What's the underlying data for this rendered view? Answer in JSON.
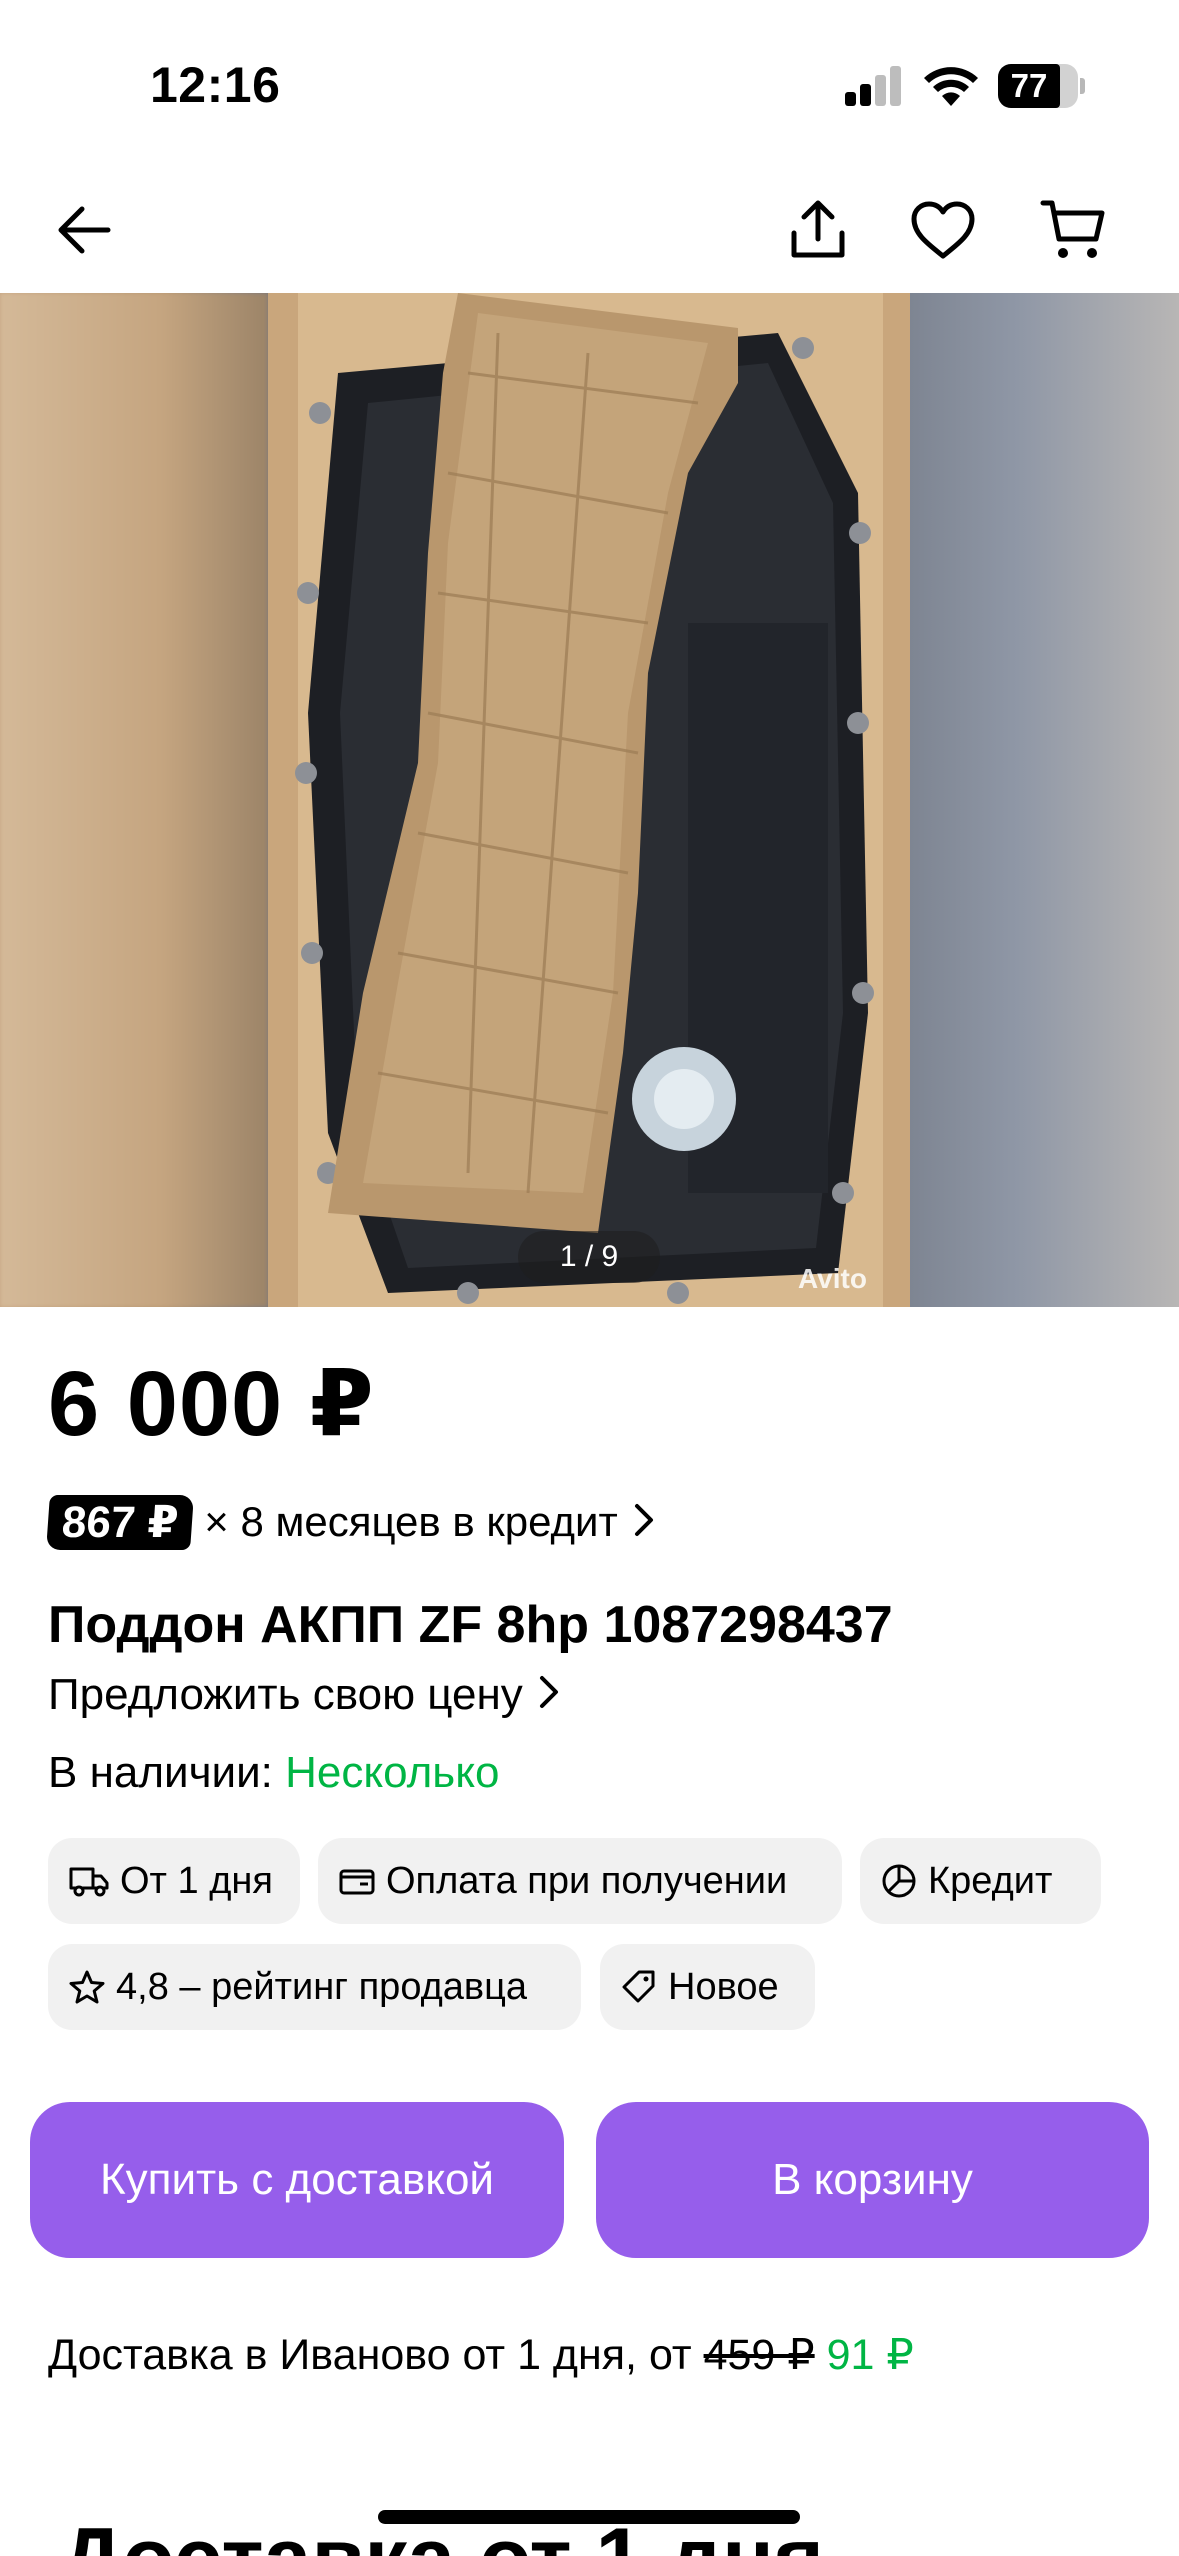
{
  "status_bar": {
    "time": "12:16",
    "battery": "77"
  },
  "nav": {
    "back": "arrow-left-icon",
    "share": "share-icon",
    "favorite": "heart-icon",
    "cart": "cart-icon"
  },
  "gallery": {
    "counter": "1 / 9",
    "watermark": "Avito"
  },
  "listing": {
    "price": "6 000 ₽",
    "credit_amount": "867 ₽",
    "credit_text": "× 8 месяцев в кредит",
    "title": "Поддон АКПП ZF 8hp 1087298437",
    "offer_price": "Предложить свою цену",
    "stock_label": "В наличии:",
    "stock_value": "Несколько"
  },
  "chips": [
    {
      "label": "От 1 дня",
      "icon": "truck-icon"
    },
    {
      "label": "Оплата при получении",
      "icon": "wallet-icon"
    },
    {
      "label": "Кредит",
      "icon": "pie-chart-icon"
    },
    {
      "label": "4,8 – рейтинг продавца",
      "icon": "star-icon"
    },
    {
      "label": "Новое",
      "icon": "tag-icon"
    }
  ],
  "actions": {
    "buy_delivery": "Купить с доставкой",
    "add_cart": "В корзину"
  },
  "delivery": {
    "text": "Доставка в Иваново от 1 дня, от",
    "old_price": "459 ₽",
    "new_price": "91 ₽"
  },
  "next_section": "Доставка от 1 дня",
  "colors": {
    "accent": "#965eeb",
    "green": "#00b544"
  }
}
